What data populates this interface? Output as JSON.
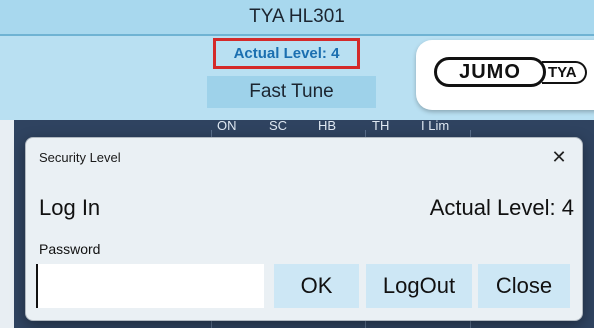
{
  "app": {
    "title": "TYA HL301",
    "actual_level": "Actual Level: 4",
    "tune_mode": "Fast Tune",
    "logo_brand": "JUMO",
    "logo_model": "TYA",
    "column_headers": [
      "ON",
      "SC",
      "HB",
      "TH",
      "I Lim"
    ]
  },
  "dialog": {
    "title": "Security Level",
    "close_icon": "close-icon",
    "heading": "Log In",
    "actual_level": "Actual Level: 4",
    "password_label": "Password",
    "password_value": "",
    "buttons": {
      "ok": "OK",
      "logout": "LogOut",
      "close": "Close"
    }
  },
  "colors": {
    "accent": "#1b6fb0",
    "highlight_border": "#d42a2a",
    "panel_dark": "#2f4360",
    "button_bg": "#cde7f5"
  }
}
